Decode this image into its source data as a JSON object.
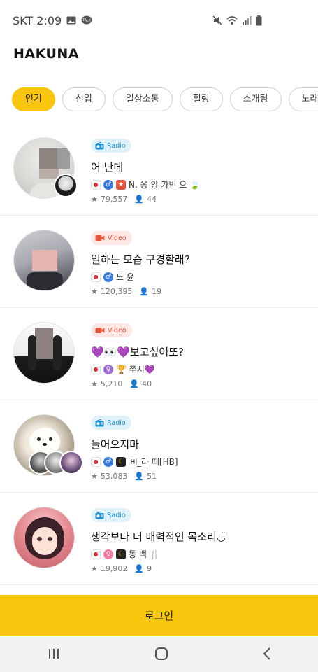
{
  "status": {
    "carrier_time": "SKT 2:09",
    "icons": [
      "image-icon",
      "talk-icon",
      "mute-icon",
      "wifi-icon",
      "signal-icon",
      "battery-icon"
    ]
  },
  "app": {
    "title": "HAKUNA",
    "accent_color": "#f9c60f"
  },
  "tabs": [
    {
      "label": "인기",
      "active": true
    },
    {
      "label": "신입",
      "active": false
    },
    {
      "label": "일상소통",
      "active": false
    },
    {
      "label": "힐링",
      "active": false
    },
    {
      "label": "소개팅",
      "active": false
    },
    {
      "label": "노래",
      "active": false
    }
  ],
  "broadcasts": [
    {
      "type": "Radio",
      "title": "어 난데",
      "host": "N. 옹 앙 가빈 으 🍃",
      "likes": "79,557",
      "viewers": "44"
    },
    {
      "type": "Video",
      "title": "일하는 모습 구경할래?",
      "host": "도 윤",
      "likes": "120,395",
      "viewers": "19"
    },
    {
      "type": "Video",
      "title": "💜👀💜보고싶어또?",
      "host": "🏆 쭈시💜",
      "likes": "5,210",
      "viewers": "40"
    },
    {
      "type": "Radio",
      "title": "들어오지마",
      "host": "🄷_라 떼[HB]",
      "likes": "53,083",
      "viewers": "51"
    },
    {
      "type": "Radio",
      "title": "생각보다 더 매력적인 목소리◡̈",
      "host": "동 백 🍴",
      "likes": "19,902",
      "viewers": "9"
    }
  ],
  "login": {
    "label": "로그인"
  }
}
